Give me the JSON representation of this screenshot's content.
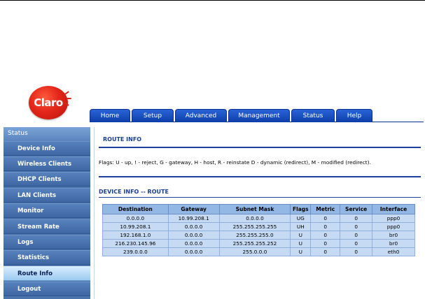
{
  "brand": {
    "logo_text": "Claro"
  },
  "nav": {
    "tabs": [
      {
        "label": "Home"
      },
      {
        "label": "Setup"
      },
      {
        "label": "Advanced"
      },
      {
        "label": "Management"
      },
      {
        "label": "Status"
      },
      {
        "label": "Help"
      }
    ]
  },
  "sidebar": {
    "header": "Status",
    "items": [
      {
        "label": "Device Info"
      },
      {
        "label": "Wireless Clients"
      },
      {
        "label": "DHCP Clients"
      },
      {
        "label": "LAN Clients"
      },
      {
        "label": "Monitor"
      },
      {
        "label": "Stream Rate"
      },
      {
        "label": "Logs"
      },
      {
        "label": "Statistics"
      },
      {
        "label": "Route Info"
      },
      {
        "label": "Logout"
      }
    ],
    "active": "Route Info"
  },
  "main": {
    "title": "ROUTE INFO",
    "flags_text": "Flags: U - up, ! - reject, G - gateway, H - host, R - reinstate D - dynamic (redirect), M - modified (redirect).",
    "section_title": "DEVICE INFO -- ROUTE",
    "table": {
      "headers": [
        "Destination",
        "Gateway",
        "Subnet Mask",
        "Flags",
        "Metric",
        "Service",
        "Interface"
      ],
      "rows": [
        [
          "0.0.0.0",
          "10.99.208.1",
          "0.0.0.0",
          "UG",
          "0",
          "0",
          "ppp0"
        ],
        [
          "10.99.208.1",
          "0.0.0.0",
          "255.255.255.255",
          "UH",
          "0",
          "0",
          "ppp0"
        ],
        [
          "192.168.1.0",
          "0.0.0.0",
          "255.255.255.0",
          "U",
          "0",
          "0",
          "br0"
        ],
        [
          "216.230.145.96",
          "0.0.0.0",
          "255.255.255.252",
          "U",
          "0",
          "0",
          "br0"
        ],
        [
          "239.0.0.0",
          "0.0.0.0",
          "255.0.0.0",
          "U",
          "0",
          "0",
          "eth0"
        ]
      ]
    }
  },
  "colors": {
    "tab_blue": "#1a4fc4",
    "sidebar_blue": "#4c74ac",
    "active_item": "#b8dcf7",
    "table_header": "#93b8e6",
    "table_cell": "#c6daf3",
    "accent_rule": "#1f3f9c"
  }
}
